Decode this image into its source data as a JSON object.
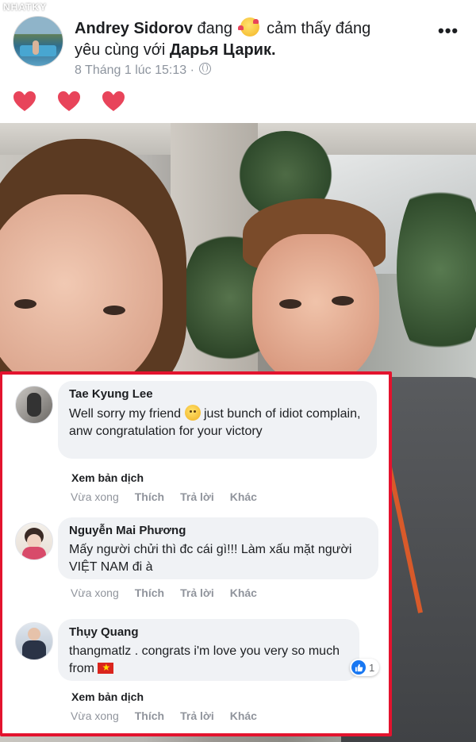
{
  "header": {
    "author": "Andrey Sidorov",
    "verb_pre": "đang",
    "feeling_rest": "cảm thấy đáng",
    "line2_pre": "yêu cùng với",
    "tagged": "Дарья Царик.",
    "timestamp": "8 Tháng 1 lúc 15:13 ·",
    "more_label": "•••",
    "watermark": "NHATKY"
  },
  "comments": [
    {
      "name": "Tae Kyung Lee",
      "text_before": "Well sorry my friend",
      "text_after": " just bunch of idiot complain, anw congratulation for your victory",
      "translate": "Xem bản dịch",
      "time": "Vừa xong",
      "like": "Thích",
      "reply": "Trả lời",
      "other": "Khác"
    },
    {
      "name": "Nguyễn Mai Phương",
      "text": "Mấy người chửi thì đc cái gì!!! Làm xấu mặt người VIỆT NAM đi à",
      "time": "Vừa xong",
      "like": "Thích",
      "reply": "Trả lời",
      "other": "Khác"
    },
    {
      "name": "Thụy Quang",
      "text_before": "thangmatlz . congrats i'm love you very so much from",
      "reaction_count": "1",
      "translate": "Xem bản dịch",
      "time": "Vừa xong",
      "like": "Thích",
      "reply": "Trả lời",
      "other": "Khác"
    }
  ],
  "colors": {
    "highlight_border": "#e3132e",
    "heart": "#e8445a",
    "like_blue": "#1877f2"
  }
}
